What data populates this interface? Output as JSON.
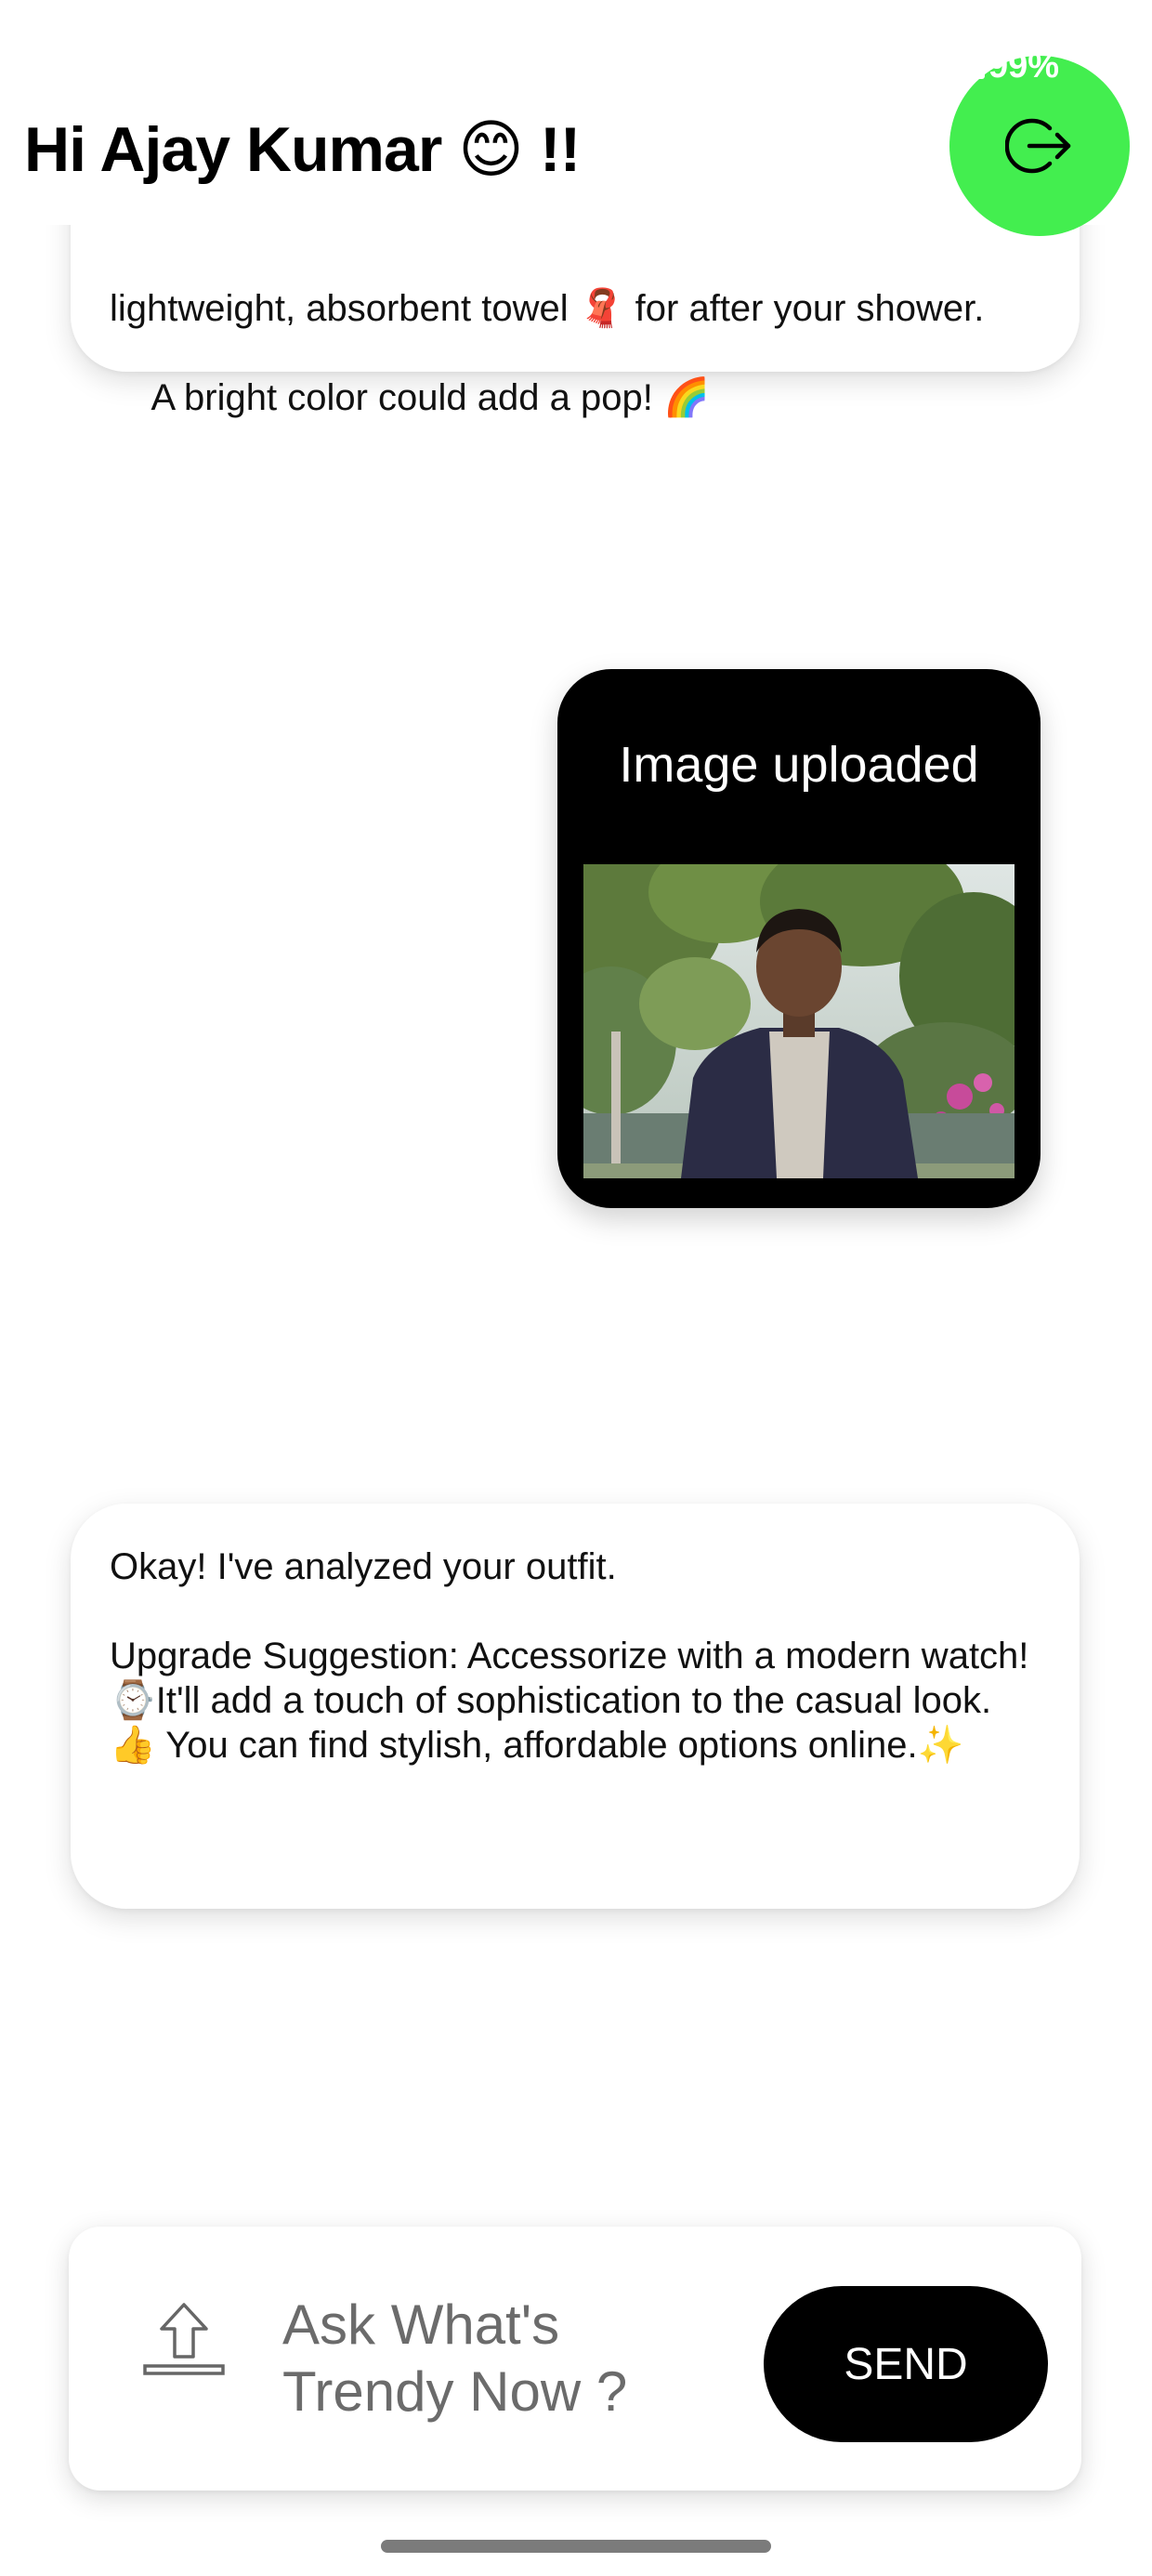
{
  "status": {
    "battery": "99%"
  },
  "header": {
    "greeting": "Hi Ajay Kumar 😊 !!",
    "logout_icon": "logout-icon"
  },
  "chat": {
    "messages": [
      {
        "role": "bot",
        "text_cut": "lightweight, absorbent towel 🧣 for after your shower.",
        "text": "A bright color could add a pop! 🌈"
      },
      {
        "role": "user",
        "label": "Image uploaded",
        "image": "photo of a man in a dark jacket standing among trees"
      },
      {
        "role": "bot",
        "text": "Okay! I've analyzed your outfit.\n\nUpgrade Suggestion: Accessorize with a modern watch!⌚It'll add a touch of sophistication to the casual look. 👍 You can find stylish, affordable options online.✨"
      }
    ]
  },
  "composer": {
    "placeholder": "Ask What's Trendy Now ?",
    "upload_icon": "upload-icon",
    "send_label": "SEND"
  },
  "colors": {
    "accent_green": "#43ee4f",
    "user_bubble": "#000000",
    "send_button": "#000000"
  }
}
